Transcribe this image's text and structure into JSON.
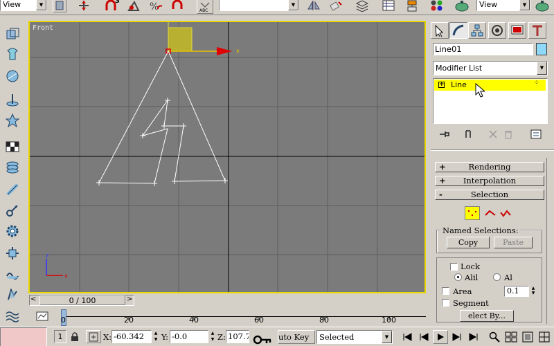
{
  "toolbar": {
    "view_combo_left": "View",
    "view_combo_right": "View",
    "icons": [
      "select-move-icon",
      "snap-3d-icon",
      "angle-snap-icon",
      "percent-snap-icon",
      "spinner-snap-icon",
      "abc-edit-named-icon",
      "mirror-icon",
      "align-icon",
      "layer-icon",
      "track-view-icon",
      "schematic-icon",
      "material-editor-icon",
      "render-scene-icon",
      "quick-render-icon"
    ],
    "snap_label": "3"
  },
  "viewport": {
    "label": "Front",
    "axis_x": "x",
    "axis_z": "z",
    "gizmo_x_label": "x"
  },
  "command_panel": {
    "tabs": [
      "create-tab-icon",
      "modify-tab-icon",
      "hierarchy-tab-icon",
      "motion-tab-icon",
      "display-tab-icon",
      "utilities-tab-icon"
    ],
    "object_name": "Line01",
    "object_color": "#8fd8f8",
    "modifier_list": "Modifier List",
    "stack_item": "Line",
    "rollouts": {
      "rendering": {
        "sign": "+",
        "title": "Rendering"
      },
      "interpolation": {
        "sign": "+",
        "title": "Interpolation"
      },
      "selection": {
        "sign": "-",
        "title": "Selection"
      }
    },
    "named_selections": {
      "title": "Named Selections:",
      "copy": "Copy",
      "paste": "Paste"
    },
    "lock_label": "Lock",
    "all_label": "Alil",
    "al_label": "Al",
    "area_label": "Area",
    "area_value": "0.1",
    "segment_label": "Segment",
    "select_by": "elect By..."
  },
  "timeline": {
    "slider_label": "0 / 100",
    "ticks": [
      "0",
      "20",
      "40",
      "60",
      "80",
      "100"
    ]
  },
  "status": {
    "selection_count": "1",
    "x_label": "X:",
    "x_value": "-60.342",
    "y_label": "Y:",
    "y_value": "-0.0",
    "z_label": "Z:",
    "z_value": "107.7",
    "auto_key": "uto Key",
    "selected": "Selected"
  },
  "colors": {
    "viewport_bg": "#7b7b7b",
    "viewport_border": "#e8d800",
    "stack_highlight": "#ffff00",
    "spline": "#ffffff",
    "gizmo_x": "#e00000",
    "gizmo_box": "#b8b030"
  }
}
